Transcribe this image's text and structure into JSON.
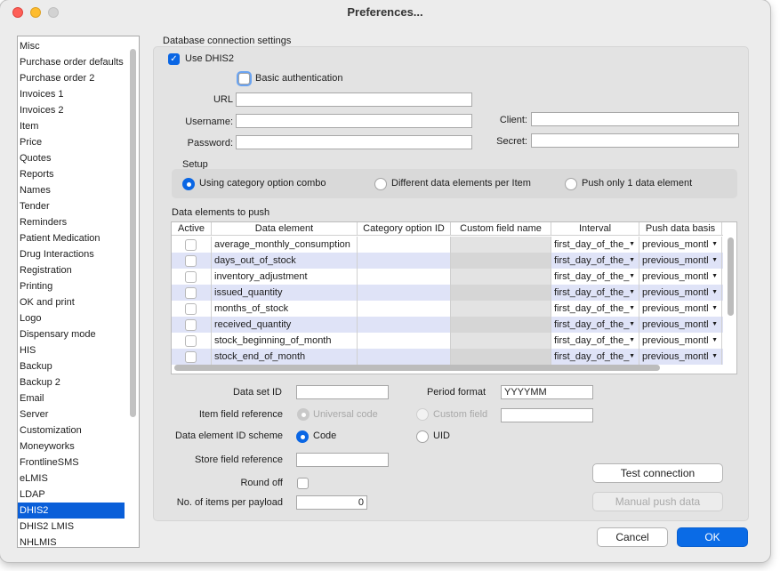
{
  "window": {
    "title": "Preferences..."
  },
  "sidebar": {
    "items": [
      "Misc",
      "Purchase order defaults",
      "Purchase order 2",
      "Invoices 1",
      "Invoices 2",
      "Item",
      "Price",
      "Quotes",
      "Reports",
      "Names",
      "Tender",
      "Reminders",
      "Patient Medication",
      "Drug Interactions",
      "Registration",
      "Printing",
      "OK and print",
      "Logo",
      "Dispensary mode",
      "HIS",
      "Backup",
      "Backup 2",
      "Email",
      "Server",
      "Customization",
      "Moneyworks",
      "FrontlineSMS",
      "eLMIS",
      "LDAP",
      "DHIS2",
      "DHIS2 LMIS",
      "NHLMIS"
    ],
    "selected": "DHIS2"
  },
  "db": {
    "section_label": "Database connection settings",
    "use_dhis2_label": "Use DHIS2",
    "basic_auth_label": "Basic authentication",
    "url_label": "URL",
    "username_label": "Username:",
    "password_label": "Password:",
    "client_label": "Client:",
    "secret_label": "Secret:",
    "url_value": "",
    "username_value": "",
    "password_value": "",
    "client_value": "",
    "secret_value": ""
  },
  "setup": {
    "label": "Setup",
    "options": [
      "Using category option combo",
      "Different data elements per Item",
      "Push only 1 data element"
    ],
    "selected_index": 0
  },
  "table": {
    "label": "Data elements to push",
    "columns": [
      "Active",
      "Data element",
      "Category option ID",
      "Custom field name",
      "Interval",
      "Push data basis"
    ],
    "rows": [
      {
        "element": "average_monthly_consumption",
        "interval": "first_day_of_the_",
        "basis": "previous_montl"
      },
      {
        "element": "days_out_of_stock",
        "interval": "first_day_of_the_",
        "basis": "previous_montl"
      },
      {
        "element": "inventory_adjustment",
        "interval": "first_day_of_the_",
        "basis": "previous_montl"
      },
      {
        "element": "issued_quantity",
        "interval": "first_day_of_the_",
        "basis": "previous_montl"
      },
      {
        "element": "months_of_stock",
        "interval": "first_day_of_the_",
        "basis": "previous_montl"
      },
      {
        "element": "received_quantity",
        "interval": "first_day_of_the_",
        "basis": "previous_montl"
      },
      {
        "element": "stock_beginning_of_month",
        "interval": "first_day_of_the_",
        "basis": "previous_montl"
      },
      {
        "element": "stock_end_of_month",
        "interval": "first_day_of_the_",
        "basis": "previous_montl"
      }
    ]
  },
  "settings": {
    "data_set_id_label": "Data set ID",
    "data_set_id_value": "",
    "period_format_label": "Period format",
    "period_format_value": "YYYYMM",
    "item_field_label": "Item field reference",
    "universal_code_label": "Universal code",
    "custom_field_label": "Custom field",
    "custom_field_value": "",
    "scheme_label": "Data element ID scheme",
    "code_label": "Code",
    "uid_label": "UID",
    "store_field_label": "Store field reference",
    "store_field_value": "",
    "round_off_label": "Round off",
    "items_per_payload_label": "No. of items per payload",
    "items_per_payload_value": "0"
  },
  "buttons": {
    "test_connection": "Test connection",
    "manual_push": "Manual push data",
    "cancel": "Cancel",
    "ok": "OK"
  },
  "colors": {
    "accent": "#0a66e4",
    "selection": "#0a5fd9",
    "row_alt": "#dfe3f7"
  }
}
